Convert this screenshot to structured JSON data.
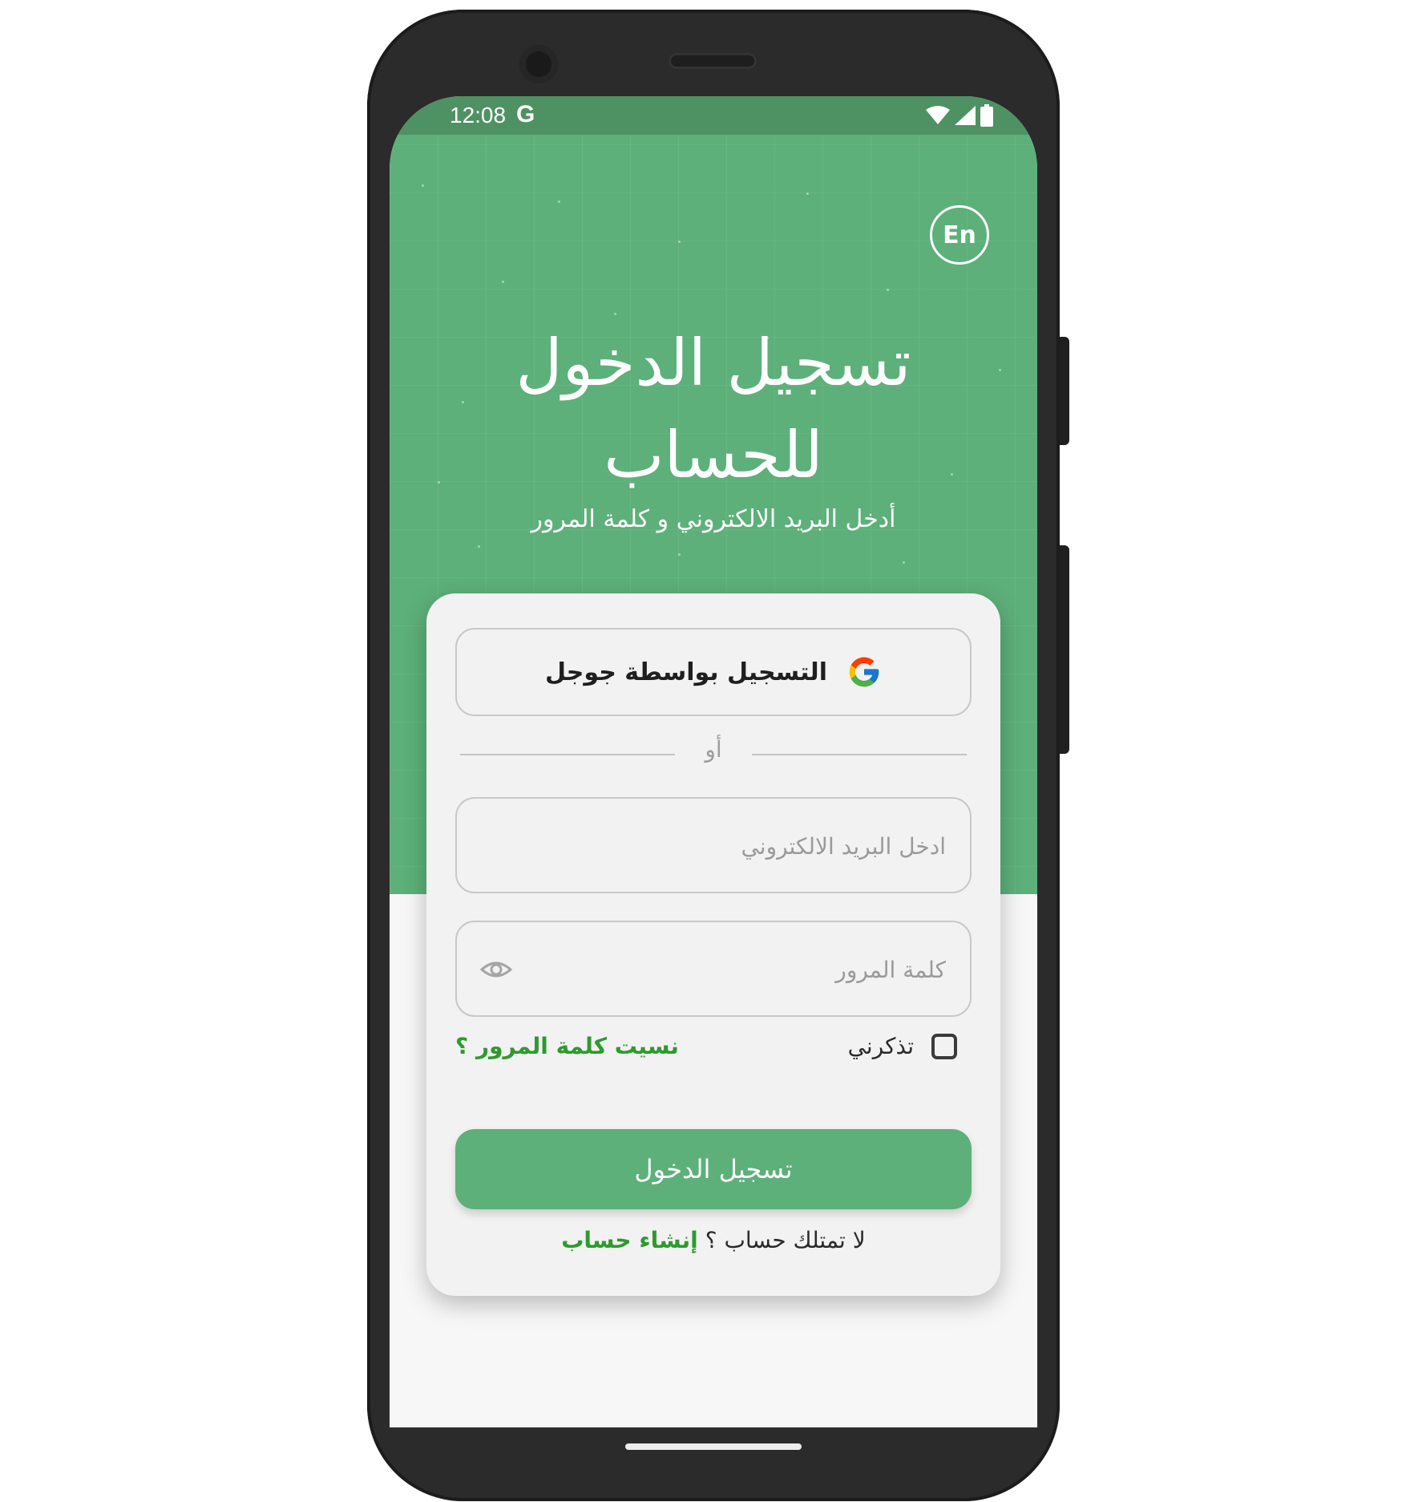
{
  "status_bar": {
    "time": "12:08",
    "carrier_glyph": "G",
    "icons": [
      "wifi-icon",
      "signal-icon",
      "battery-icon"
    ]
  },
  "header": {
    "language_button": "En",
    "title": "تسجيل الدخول للحساب",
    "subtitle": "أدخل البريد الالكتروني و كلمة المرور"
  },
  "form": {
    "google_button_label": "التسجيل بواسطة جوجل",
    "or_label": "أو",
    "email_placeholder": "ادخل البريد الالكتروني",
    "email_value": "",
    "password_placeholder": "كلمة المرور",
    "password_value": "",
    "remember_me_label": "تذكرني",
    "remember_me_checked": false,
    "forgot_password_label": "نسيت كلمة المرور ؟",
    "login_button_label": "تسجيل الدخول",
    "no_account_text": "لا تمتلك حساب ؟",
    "create_account_label": "إنشاء حساب"
  },
  "colors": {
    "primary_green": "#5db07a",
    "status_bar_green": "#4e9263",
    "link_green": "#2e9a2e",
    "card_background": "#f2f2f2",
    "phone_frame": "#2b2b2b"
  }
}
